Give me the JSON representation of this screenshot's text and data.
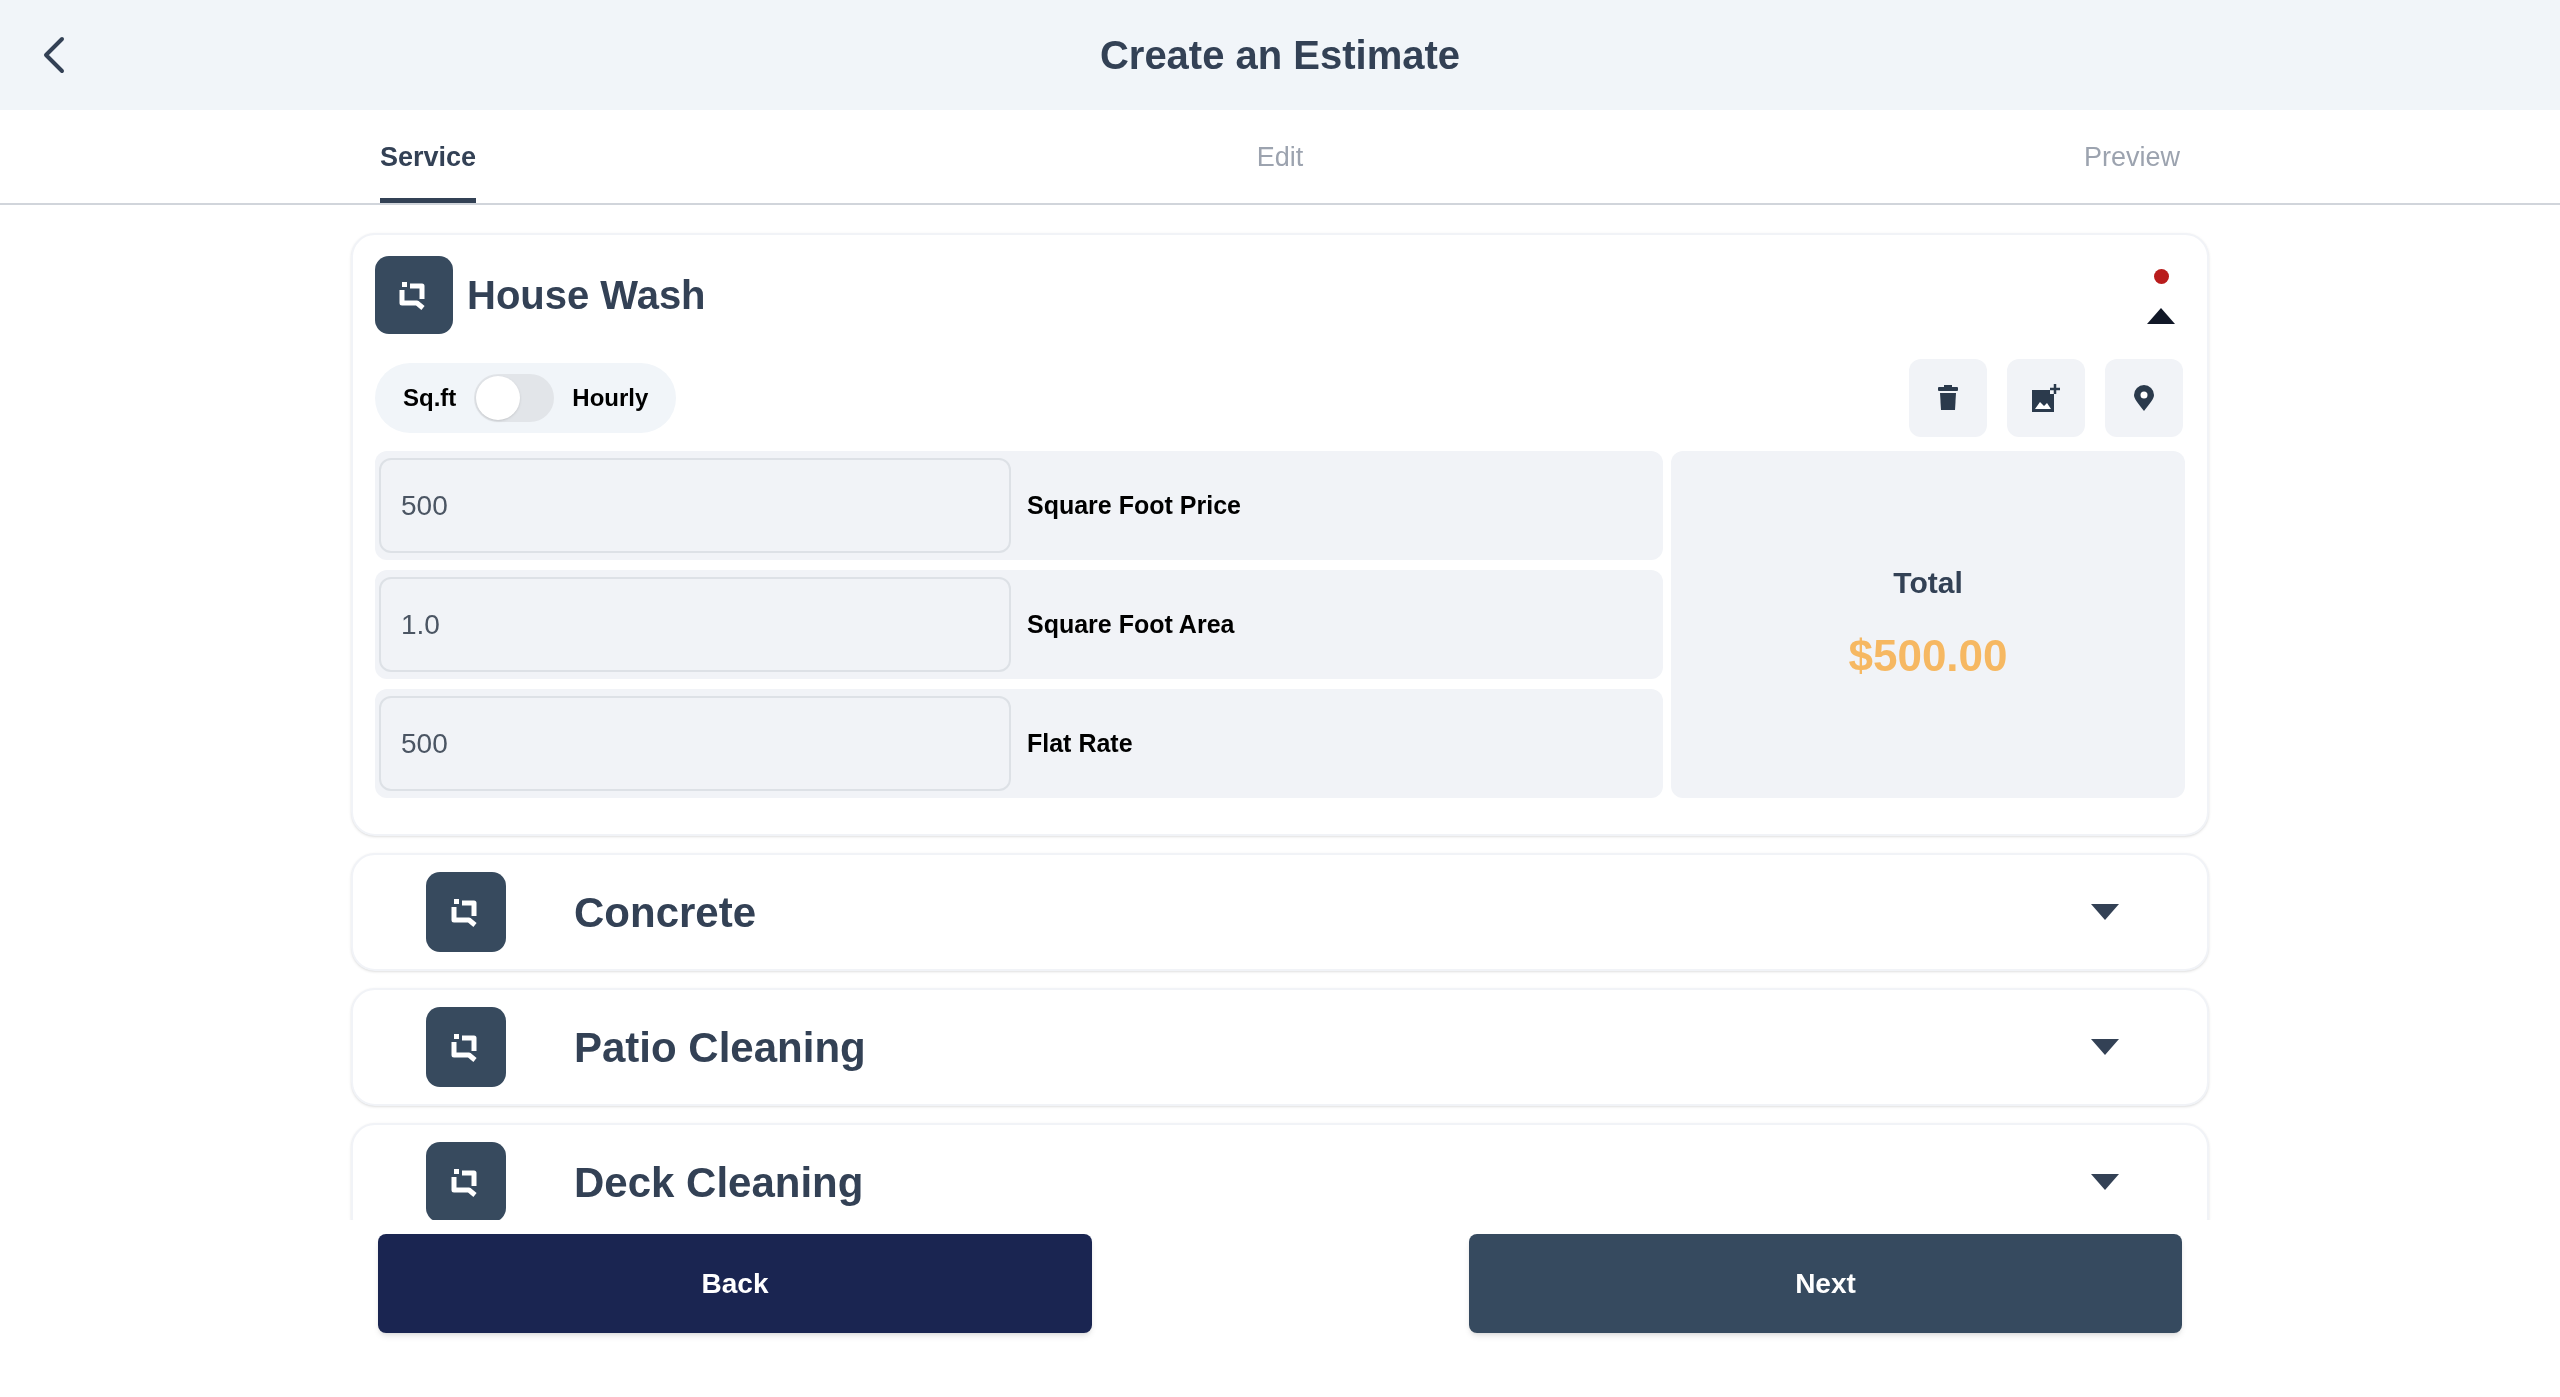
{
  "header": {
    "title": "Create an Estimate"
  },
  "tabs": [
    {
      "label": "Service",
      "selected": true
    },
    {
      "label": "Edit",
      "selected": false
    },
    {
      "label": "Preview",
      "selected": false
    }
  ],
  "services": [
    {
      "name": "House Wash",
      "expanded": true,
      "indicator": true,
      "toggle": {
        "left_label": "Sq.ft",
        "right_label": "Hourly",
        "on": false
      },
      "fields": [
        {
          "value": "500",
          "label": "Square Foot Price"
        },
        {
          "value": "1.0",
          "label": "Square Foot Area"
        },
        {
          "value": "500",
          "label": "Flat Rate"
        }
      ],
      "total": {
        "label": "Total",
        "amount": "$500.00"
      }
    },
    {
      "name": "Concrete",
      "expanded": false,
      "indicator": false
    },
    {
      "name": "Patio Cleaning",
      "expanded": false,
      "indicator": false
    },
    {
      "name": "Deck Cleaning",
      "expanded": false,
      "indicator": false
    }
  ],
  "footer": {
    "back": "Back",
    "next": "Next"
  }
}
